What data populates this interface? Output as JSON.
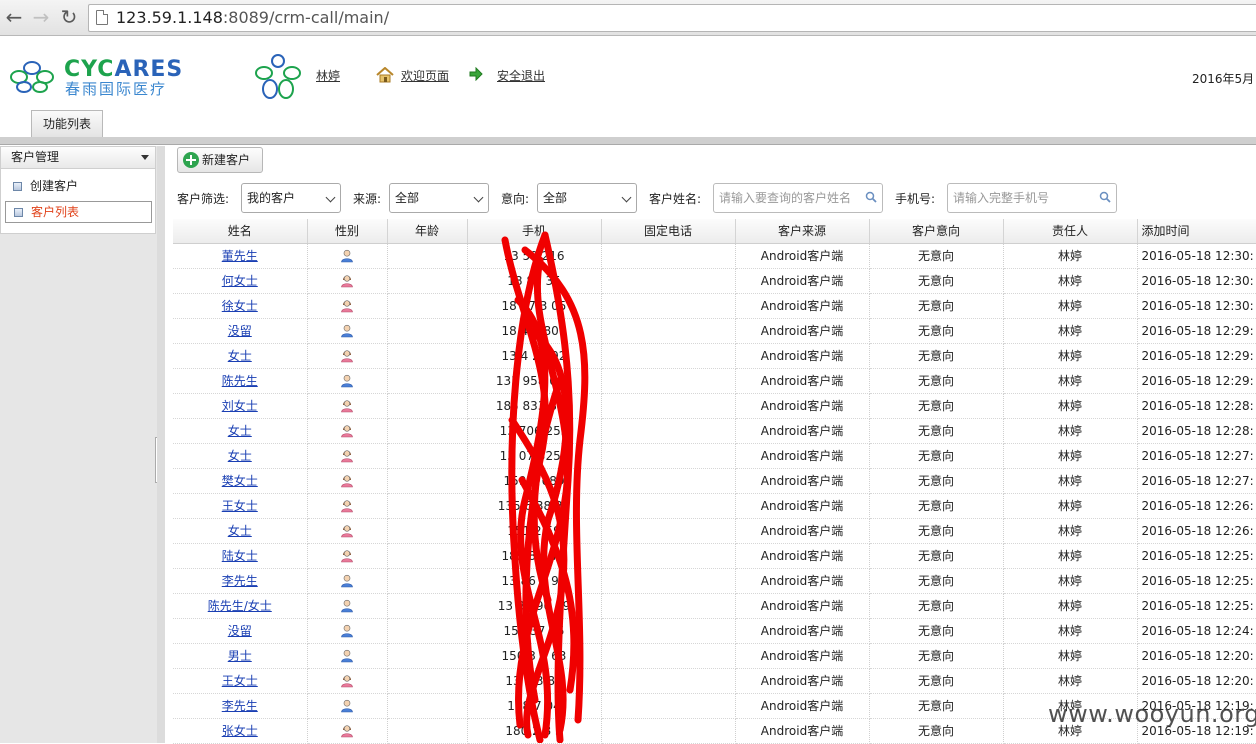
{
  "browser": {
    "url_host": "123.59.1.148",
    "url_rest": ":8089/crm-call/main/"
  },
  "header": {
    "logo_en_1": "CYC",
    "logo_en_2": "ARES",
    "logo_cn": "春雨国际医疗",
    "user": "林婷",
    "welcome": "欢迎页面",
    "logout": "安全退出",
    "date": "2016年5月",
    "function_tab": "功能列表"
  },
  "sidebar": {
    "group": "客户管理",
    "items": [
      {
        "label": "创建客户"
      },
      {
        "label": "客户列表"
      }
    ]
  },
  "toolbar": {
    "new_customer": "新建客户"
  },
  "filters": {
    "filter_label": "客户筛选:",
    "filter_value": "我的客户",
    "source_label": "来源:",
    "source_value": "全部",
    "intent_label": "意向:",
    "intent_value": "全部",
    "name_label": "客户姓名:",
    "name_placeholder": "请输入要查询的客户姓名",
    "phone_label": "手机号:",
    "phone_placeholder": "请输入完整手机号"
  },
  "table": {
    "columns": [
      "姓名",
      "性别",
      "年龄",
      "手机",
      "固定电话",
      "客户来源",
      "客户意向",
      "责任人",
      "添加时间"
    ],
    "rows": [
      {
        "name": "董先生",
        "gender": "male",
        "age": "",
        "phone": "13 59 216",
        "landline": "",
        "source": "Android客户端",
        "intent": "无意向",
        "owner": "林婷",
        "time": "2016-05-18 12:30:"
      },
      {
        "name": "何女士",
        "gender": "female",
        "age": "",
        "phone": "18 80 35",
        "landline": "",
        "source": "Android客户端",
        "intent": "无意向",
        "owner": "林婷",
        "time": "2016-05-18 12:30:"
      },
      {
        "name": "徐女士",
        "gender": "female",
        "age": "",
        "phone": "18 57 3 05",
        "landline": "",
        "source": "Android客户端",
        "intent": "无意向",
        "owner": "林婷",
        "time": "2016-05-18 12:30:"
      },
      {
        "name": "没留",
        "gender": "male",
        "age": "",
        "phone": "18 4 6 809",
        "landline": "",
        "source": "Android客户端",
        "intent": "无意向",
        "owner": "林婷",
        "time": "2016-05-18 12:29:"
      },
      {
        "name": "女士",
        "gender": "female",
        "age": "",
        "phone": "13 4 2 992",
        "landline": "",
        "source": "Android客户端",
        "intent": "无意向",
        "owner": "林婷",
        "time": "2016-05-18 12:29:"
      },
      {
        "name": "陈先生",
        "gender": "male",
        "age": "",
        "phone": "135 958 038",
        "landline": "",
        "source": "Android客户端",
        "intent": "无意向",
        "owner": "林婷",
        "time": "2016-05-18 12:29:"
      },
      {
        "name": "刘女士",
        "gender": "female",
        "age": "",
        "phone": "185 833 886",
        "landline": "",
        "source": "Android客户端",
        "intent": "无意向",
        "owner": "林婷",
        "time": "2016-05-18 12:28:"
      },
      {
        "name": "女士",
        "gender": "female",
        "age": "",
        "phone": "13 706 255",
        "landline": "",
        "source": "Android客户端",
        "intent": "无意向",
        "owner": "林婷",
        "time": "2016-05-18 12:28:"
      },
      {
        "name": "女士",
        "gender": "female",
        "age": "",
        "phone": "13 07 3255",
        "landline": "",
        "source": "Android客户端",
        "intent": "无意向",
        "owner": "林婷",
        "time": "2016-05-18 12:27:"
      },
      {
        "name": "樊女士",
        "gender": "female",
        "age": "",
        "phone": "159 0 089",
        "landline": "",
        "source": "Android客户端",
        "intent": "无意向",
        "owner": "林婷",
        "time": "2016-05-18 12:27:"
      },
      {
        "name": "王女士",
        "gender": "female",
        "age": "",
        "phone": "135 6 38 38",
        "landline": "",
        "source": "Android客户端",
        "intent": "无意向",
        "owner": "林婷",
        "time": "2016-05-18 12:26:"
      },
      {
        "name": "女士",
        "gender": "female",
        "age": "",
        "phone": "151 2 59",
        "landline": "",
        "source": "Android客户端",
        "intent": "无意向",
        "owner": "林婷",
        "time": "2016-05-18 12:26:"
      },
      {
        "name": "陆女士",
        "gender": "female",
        "age": "",
        "phone": "189 8 0 77",
        "landline": "",
        "source": "Android客户端",
        "intent": "无意向",
        "owner": "林婷",
        "time": "2016-05-18 12:25:"
      },
      {
        "name": "李先生",
        "gender": "male",
        "age": "",
        "phone": "13 86 2 94",
        "landline": "",
        "source": "Android客户端",
        "intent": "无意向",
        "owner": "林婷",
        "time": "2016-05-18 12:25:"
      },
      {
        "name": "陈先生/女士",
        "gender": "male",
        "age": "",
        "phone": "13 85 90 89",
        "landline": "",
        "source": "Android客户端",
        "intent": "无意向",
        "owner": "林婷",
        "time": "2016-05-18 12:25:"
      },
      {
        "name": "没留",
        "gender": "male",
        "age": "",
        "phone": "15 437 75",
        "landline": "",
        "source": "Android客户端",
        "intent": "无意向",
        "owner": "林婷",
        "time": "2016-05-18 12:24:"
      },
      {
        "name": "男士",
        "gender": "male",
        "age": "",
        "phone": "150 3 9 63",
        "landline": "",
        "source": "Android客户端",
        "intent": "无意向",
        "owner": "林婷",
        "time": "2016-05-18 12:20:"
      },
      {
        "name": "王女士",
        "gender": "female",
        "age": "",
        "phone": "13 2 3 88",
        "landline": "",
        "source": "Android客户端",
        "intent": "无意向",
        "owner": "林婷",
        "time": "2016-05-18 12:20:"
      },
      {
        "name": "李先生",
        "gender": "male",
        "age": "",
        "phone": "138 7 04",
        "landline": "",
        "source": "Android客户端",
        "intent": "无意向",
        "owner": "林婷",
        "time": "2016-05-18 12:19:"
      },
      {
        "name": "张女士",
        "gender": "female",
        "age": "",
        "phone": "180 2 8 3",
        "landline": "",
        "source": "Android客户端",
        "intent": "无意向",
        "owner": "林婷",
        "time": "2016-05-18 12:19:"
      }
    ]
  },
  "colors": {
    "link": "#1a3fb3",
    "active_item": "#e0421a",
    "scribble": "#f00000",
    "male_icon": "#4a7fd6",
    "female_icon": "#e87a9a"
  },
  "watermark": "www.wooyun.org"
}
